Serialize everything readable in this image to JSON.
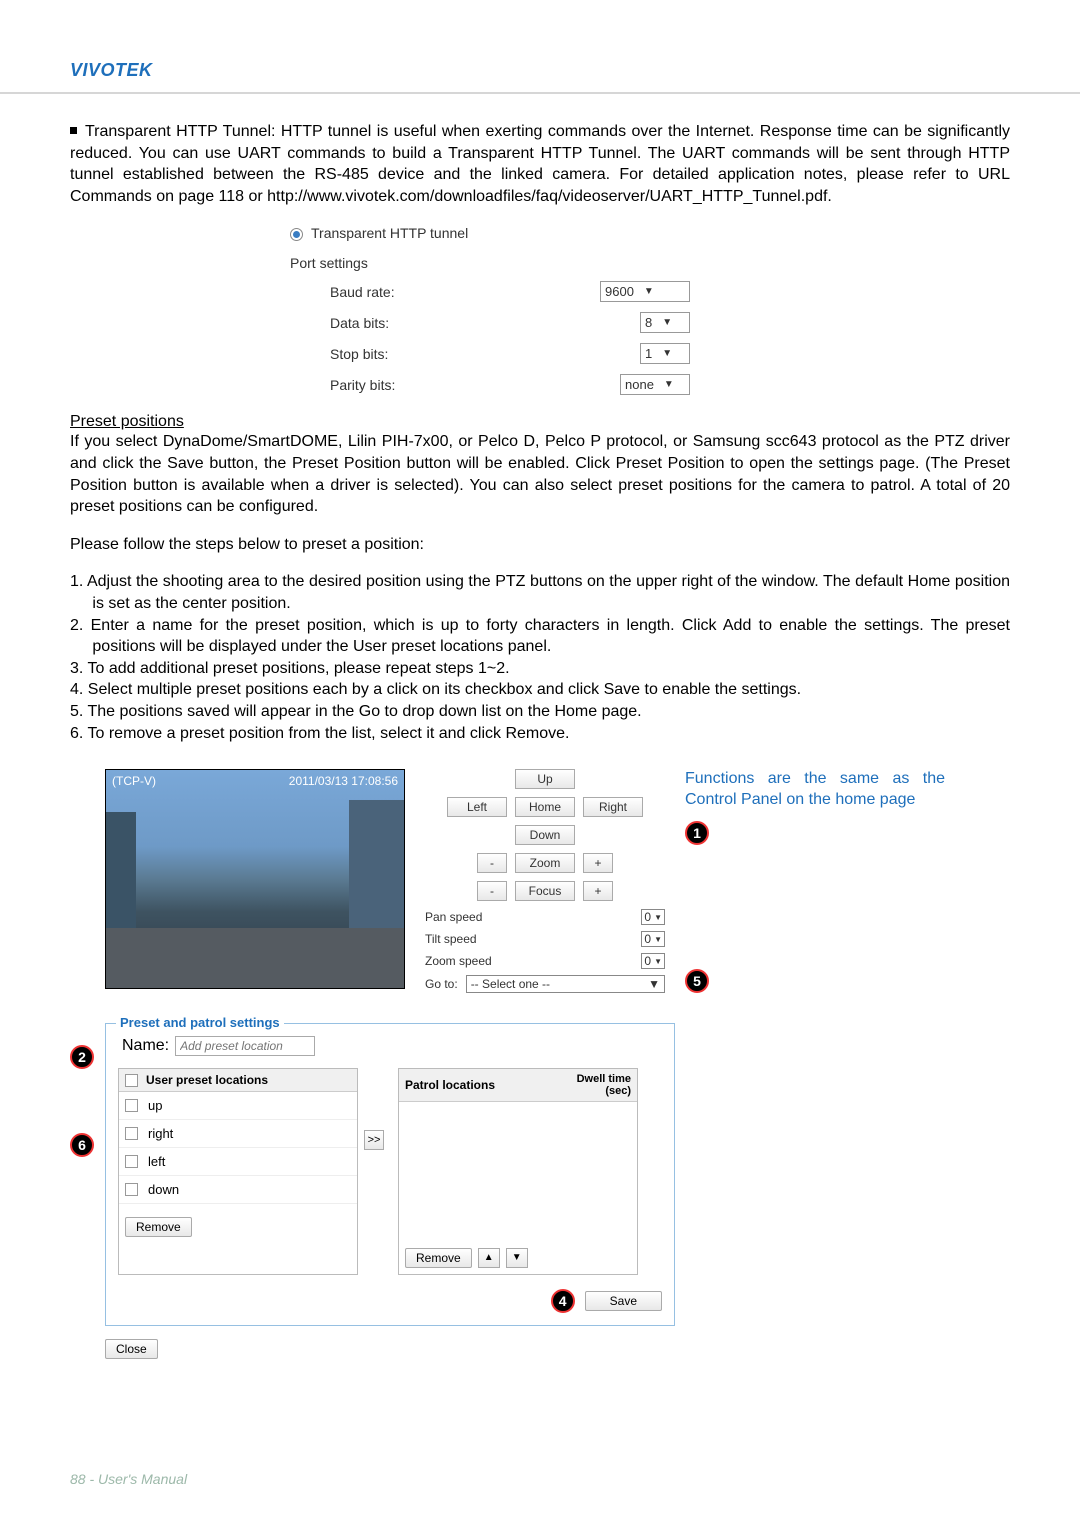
{
  "brand": "VIVOTEK",
  "intro_p1_prefix": "Transparent HTTP Tunnel:  HTTP tunnel is useful when exerting commands over the Internet. Response time can be significantly reduced. You can use UART commands to build a Transparent HTTP Tunnel. The UART commands will be sent through HTTP tunnel established between the RS-485 device and the linked camera. For detailed application notes, please refer to URL Commands on page 118 or http://www.vivotek.com/downloadfiles/faq/videoserver/UART_HTTP_Tunnel.pdf.",
  "radio_label": "Transparent HTTP tunnel",
  "port_settings_title": "Port settings",
  "port": {
    "baud_label": "Baud rate:",
    "baud_val": "9600",
    "data_label": "Data bits:",
    "data_val": "8",
    "stop_label": "Stop bits:",
    "stop_val": "1",
    "parity_label": "Parity bits:",
    "parity_val": "none"
  },
  "preset_heading": "Preset positions",
  "preset_p": "If you select DynaDome/SmartDOME, Lilin PIH-7x00, or Pelco D, Pelco P protocol, or Samsung scc643 protocol as the PTZ driver and click the Save button, the Preset Position button will be enabled. Click Preset Position to open the settings page. (The Preset Position button is available when a driver is selected). You can also select preset positions for the camera to patrol. A total of 20 preset positions can be configured.",
  "preset_prepend": "Please follow the steps below to preset a position:",
  "steps": {
    "s1": "1. Adjust the shooting area to the desired position using the PTZ buttons on the upper right of the window. The default Home position is set as the center position.",
    "s2": "2. Enter a name for the preset position, which is up to forty characters in length. Click Add to enable the settings. The preset positions will be displayed under the User preset locations panel.",
    "s3": "3. To add additional preset positions, please repeat steps 1~2.",
    "s4": "4. Select multiple preset positions each by a click on its checkbox and click Save to enable the settings.",
    "s5": "5. The positions saved will appear in the Go to drop down list on the Home page.",
    "s6": "6. To remove a preset position from the list, select it and click Remove."
  },
  "video": {
    "title": "(TCP-V)",
    "timestamp": "2011/03/13 17:08:56"
  },
  "ctrl": {
    "up": "Up",
    "left": "Left",
    "home": "Home",
    "right": "Right",
    "down": "Down",
    "zoom": "Zoom",
    "focus": "Focus",
    "minus": "-",
    "plus": "+",
    "pan": "Pan speed",
    "tilt": "Tilt speed",
    "zooms": "Zoom speed",
    "speed_val": "0",
    "goto": "Go to:",
    "goto_sel": "-- Select one --"
  },
  "note": "Functions are the same as the Control Panel on the home page",
  "bubbles": {
    "b1": "1",
    "b2": "2",
    "b4": "4",
    "b5": "5",
    "b6": "6"
  },
  "panel": {
    "legend": "Preset and patrol settings",
    "name_lbl": "Name:",
    "name_ph": "Add preset location",
    "user_head": "User preset locations",
    "patrol_head": "Patrol locations",
    "dwell": "Dwell time (sec)",
    "items": {
      "i1": "up",
      "i2": "right",
      "i3": "left",
      "i4": "down"
    },
    "remove": "Remove",
    "save": "Save",
    "close": "Close",
    "transfer": ">>",
    "up_ar": "▲",
    "dn_ar": "▼"
  },
  "footer": "88 - User's Manual"
}
